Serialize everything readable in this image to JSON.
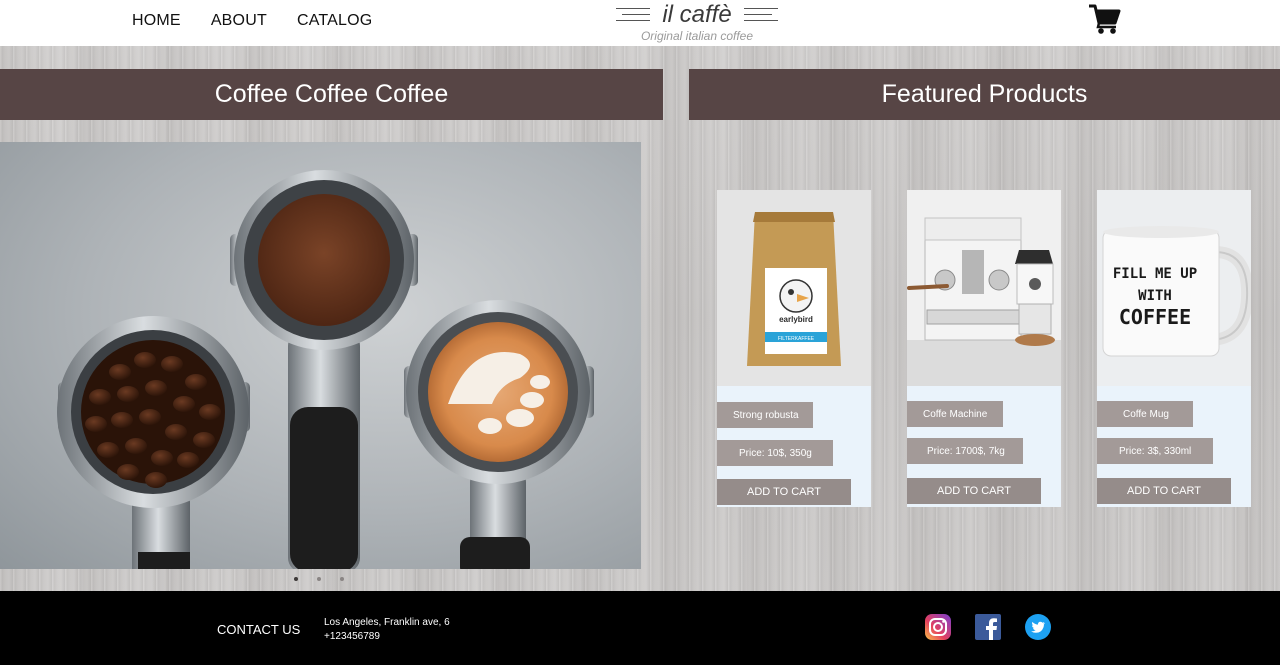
{
  "nav": {
    "home": "HOME",
    "about": "ABOUT",
    "catalog": "CATALOG"
  },
  "logo": {
    "title": "il caffè",
    "subtitle": "Original italian coffee"
  },
  "cart": {
    "icon": "shopping-cart-icon"
  },
  "left_banner": {
    "title": "Coffee Coffee Coffee"
  },
  "right_banner": {
    "title": "Featured Products"
  },
  "slider": {
    "dots": 3,
    "active": 1
  },
  "products": [
    {
      "name": "Strong robusta",
      "price": "Price: 10$, 350g",
      "button": "ADD TO CART",
      "bag_brand": "earlybird",
      "bag_label": "FILTERKAFFEE"
    },
    {
      "name": "Coffe Machine",
      "price": "Price: 1700$, 7kg",
      "button": "ADD TO CART"
    },
    {
      "name": "Coffe Mug",
      "price": "Price: 3$, 330ml",
      "button": "ADD TO CART",
      "mug_text": [
        "FILL ME UP",
        "WITH",
        "COFFEE"
      ]
    }
  ],
  "footer": {
    "contact_title": "CONTACT US",
    "address": "Los Angeles, Franklin ave, 6",
    "phone": "+123456789",
    "social": [
      "instagram-icon",
      "facebook-icon",
      "twitter-icon"
    ]
  },
  "colors": {
    "banner": "#574545",
    "tag": "#a39a98",
    "button": "#958c8a",
    "footer": "#000000"
  }
}
